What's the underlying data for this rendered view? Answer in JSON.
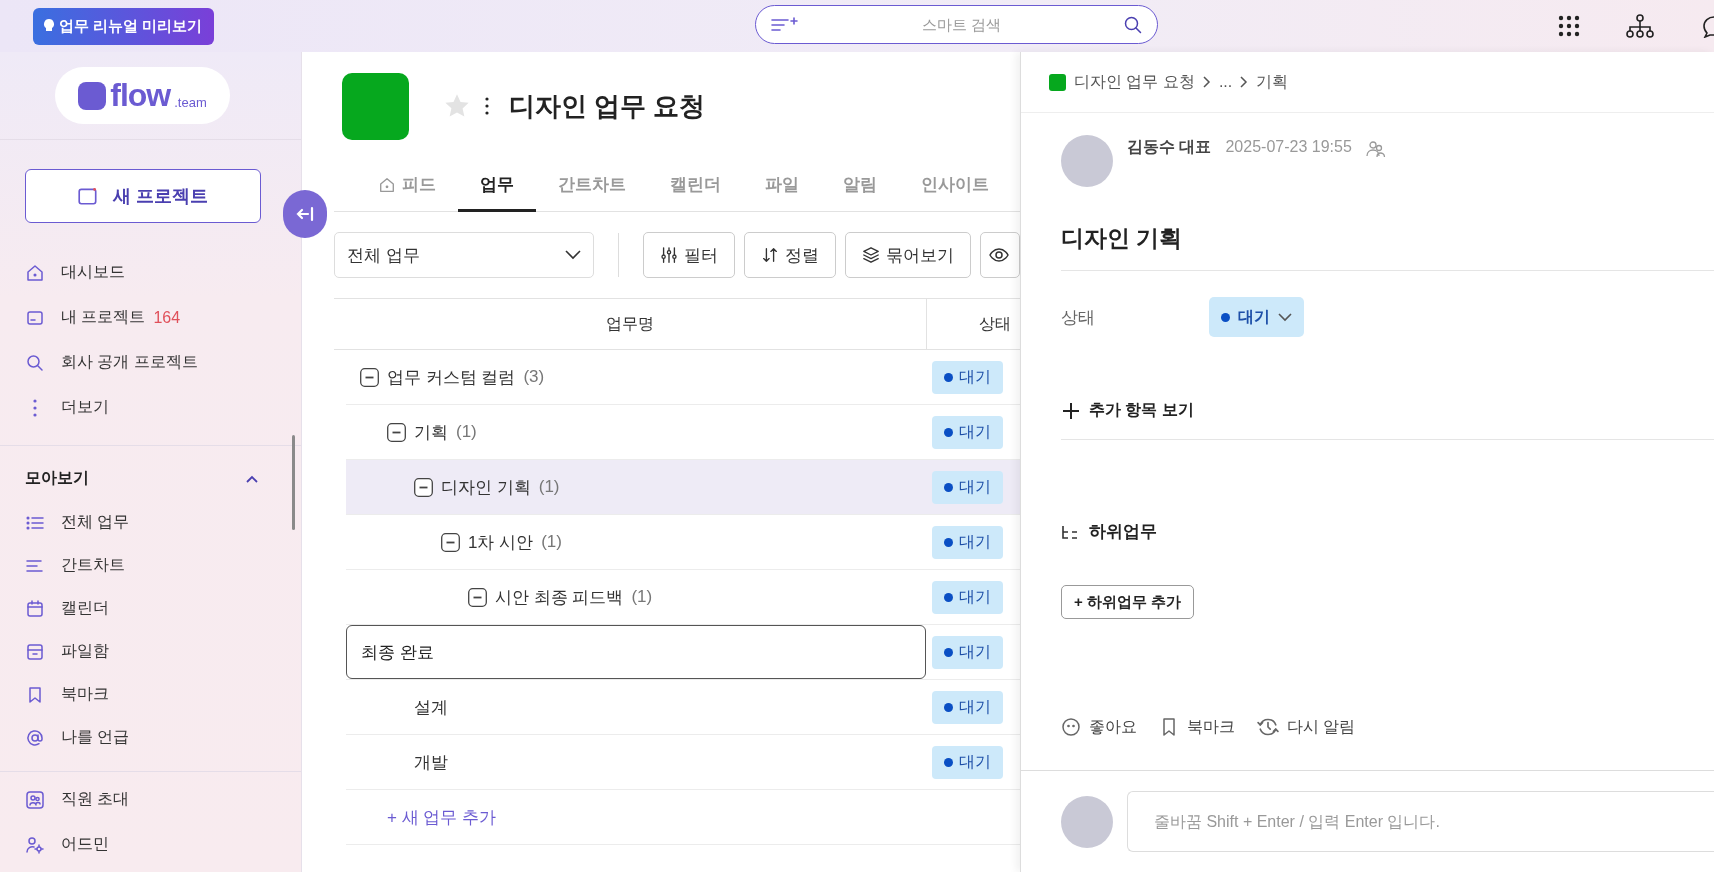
{
  "top_bar": {
    "preview_badge": "업무 리뉴얼 미리보기",
    "search": {
      "placeholder": "스마트 검색"
    }
  },
  "sidebar": {
    "logo": {
      "word": "flow",
      "suffix": ".team"
    },
    "new_project_button": "새 프로젝트",
    "nav_items": [
      {
        "label": "대시보드"
      },
      {
        "label": "내 프로젝트",
        "count": "164"
      },
      {
        "label": "회사 공개 프로젝트"
      },
      {
        "label": "더보기"
      }
    ],
    "section": {
      "title": "모아보기",
      "expanded": true,
      "items": [
        {
          "label": "전체 업무"
        },
        {
          "label": "간트차트"
        },
        {
          "label": "캘린더"
        },
        {
          "label": "파일함"
        },
        {
          "label": "북마크"
        },
        {
          "label": "나를 언급"
        }
      ]
    },
    "footer_items": [
      {
        "label": "직원 초대"
      },
      {
        "label": "어드민"
      }
    ]
  },
  "project": {
    "title": "디자인 업무 요청",
    "starred": false
  },
  "tabs": [
    {
      "label": "피드",
      "selected": false
    },
    {
      "label": "업무",
      "selected": true
    },
    {
      "label": "간트차트",
      "selected": false
    },
    {
      "label": "캘린더",
      "selected": false
    },
    {
      "label": "파일",
      "selected": false
    },
    {
      "label": "알림",
      "selected": false
    },
    {
      "label": "인사이트",
      "selected": false
    }
  ],
  "toolbar": {
    "view_select": "전체 업무",
    "buttons": [
      "필터",
      "정렬",
      "묶어보기"
    ]
  },
  "table": {
    "columns": [
      "업무명",
      "상태"
    ],
    "rows": [
      {
        "name": "업무 커스텀 컬럼",
        "count": "(3)",
        "status": "대기",
        "selected": false,
        "editing": false,
        "expanded": true,
        "children": [
          {
            "name": "기획",
            "count": "(1)",
            "status": "대기",
            "selected": false,
            "editing": false,
            "expanded": true,
            "children": [
              {
                "name": "디자인 기획",
                "count": "(1)",
                "status": "대기",
                "selected": true,
                "editing": false,
                "expanded": true,
                "children": [
                  {
                    "name": "1차 시안",
                    "count": "(1)",
                    "status": "대기",
                    "selected": false,
                    "editing": false,
                    "expanded": true,
                    "children": [
                      {
                        "name": "시안 최종 피드백",
                        "count": "(1)",
                        "status": "대기",
                        "selected": false,
                        "editing": false,
                        "expanded": true,
                        "children": [
                          {
                            "name": "최종 완료",
                            "status": "대기",
                            "selected": false,
                            "editing": true
                          }
                        ]
                      }
                    ]
                  }
                ]
              }
            ]
          },
          {
            "name": "설계",
            "status": "대기",
            "selected": false,
            "editing": false
          },
          {
            "name": "개발",
            "status": "대기",
            "selected": false,
            "editing": false
          }
        ]
      }
    ],
    "add_row": "+ 새 업무 추가"
  },
  "detail": {
    "breadcrumb": [
      "디자인 업무 요청",
      "...",
      "기획"
    ],
    "author": "김동수 대표",
    "date": "2025-07-23 19:55",
    "title": "디자인 기획",
    "fields": [
      {
        "label": "상태",
        "value": "대기"
      }
    ],
    "more_fields": "추가 항목 보기",
    "subtasks": {
      "title": "하위업무",
      "add_button": "+ 하위업무 추가"
    },
    "actions": [
      "좋아요",
      "북마크",
      "다시 알림"
    ],
    "comment": {
      "placeholder": "줄바꿈 Shift + Enter / 입력 Enter 입니다."
    }
  }
}
